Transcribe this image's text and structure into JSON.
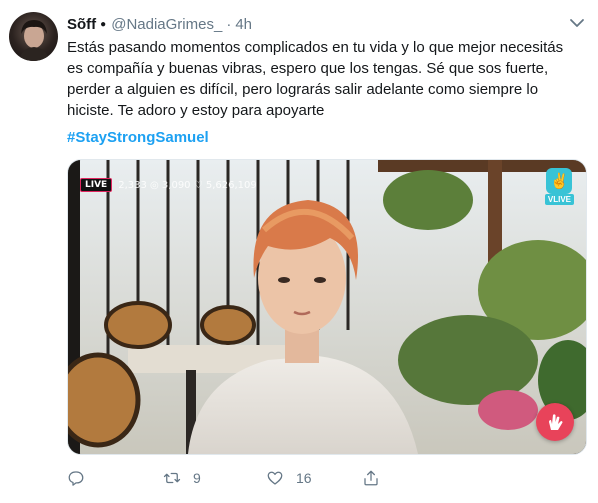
{
  "tweet": {
    "author_name": "Sõff",
    "badge": "●",
    "handle": "@NadiaGrimes_",
    "separator": "·",
    "time": "4h",
    "text": "Estás pasando momentos complicados en tu vida y lo que mejor necesitás es compañía y buenas vibras, espero que los tengas. Sé que sos fuerte, perder a alguien es difícil, pero lograrás salir adelante como siempre lo hiciste. Te adoro y estoy para apoyarte",
    "hashtag": "#StayStrongSamuel"
  },
  "media": {
    "live_label": "LIVE",
    "stats": "2,333 ◎ 3,090 ♡ 5,626,109",
    "vlive_logo": "VLIVE",
    "vlive_mark": "✌"
  },
  "actions": {
    "reply_count": "",
    "retweet_count": "9",
    "like_count": "16"
  },
  "colors": {
    "accent": "#1da1f2",
    "muted": "#657786",
    "live_fab": "#e8435a",
    "vlive": "#38c3d6"
  },
  "icons": [
    "reply-icon",
    "retweet-icon",
    "like-icon",
    "share-icon",
    "chevron-down-icon",
    "hand-heart-icon"
  ]
}
